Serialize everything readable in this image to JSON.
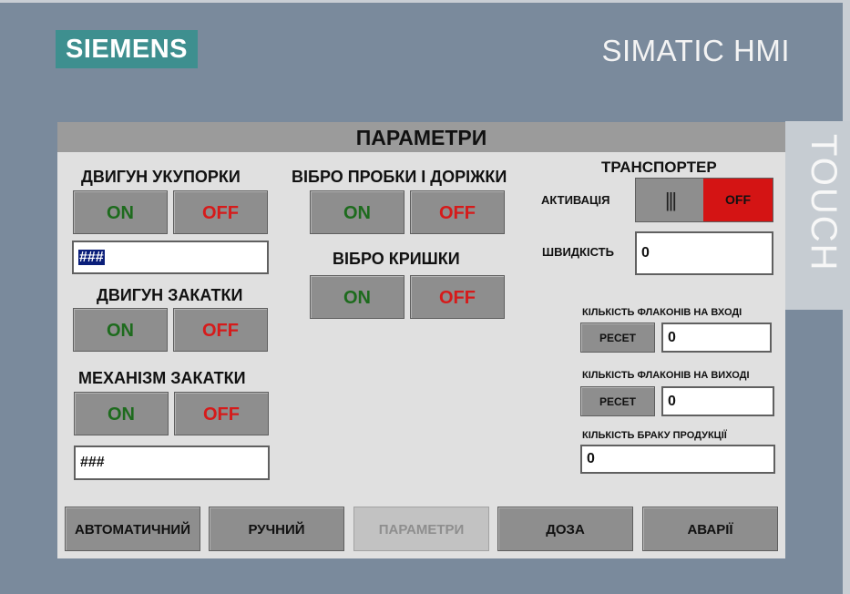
{
  "device": {
    "brand": "SIEMENS",
    "model": "SIMATIC HMI",
    "touch_label": "TOUCH"
  },
  "screen": {
    "title": "ПАРАМЕТРИ",
    "motor_capping": {
      "label": "ДВИГУН УКУПОРКИ",
      "on_label": "ON",
      "off_label": "OFF",
      "value": "###"
    },
    "motor_crimping": {
      "label": "ДВИГУН ЗАКАТКИ",
      "on_label": "ON",
      "off_label": "OFF"
    },
    "crimping_mechanism": {
      "label": "МЕХАНІЗМ ЗАКАТКИ",
      "on_label": "ON",
      "off_label": "OFF",
      "value": "###"
    },
    "vibro_cork_track": {
      "label": "ВІБРО ПРОБКИ І ДОРІЖКИ",
      "on_label": "ON",
      "off_label": "OFF"
    },
    "vibro_lids": {
      "label": "ВІБРО КРИШКИ",
      "on_label": "ON",
      "off_label": "OFF"
    },
    "conveyor": {
      "title": "ТРАНСПОРТЕР",
      "activation_label": "АКТИВАЦІЯ",
      "toggle_knob": "|||",
      "toggle_state": "OFF",
      "speed_label": "ШВИДКІСТЬ",
      "speed_value": "0"
    },
    "counters": {
      "input_label": "КІЛЬКІСТЬ ФЛАКОНІВ НА ВХОДІ",
      "input_reset": "РЕСЕТ",
      "input_value": "0",
      "output_label": "КІЛЬКІСТЬ ФЛАКОНІВ НА ВИХОДІ",
      "output_reset": "РЕСЕТ",
      "output_value": "0",
      "defects_label": "КІЛЬКІСТЬ БРАКУ ПРОДУКЦІЇ",
      "defects_value": "0"
    },
    "nav": [
      {
        "label": "АВТОМАТИЧНИЙ",
        "enabled": true
      },
      {
        "label": "РУЧНИЙ",
        "enabled": true
      },
      {
        "label": "ПАРАМЕТРИ",
        "enabled": false
      },
      {
        "label": "ДОЗА",
        "enabled": true
      },
      {
        "label": "АВАРІЇ",
        "enabled": true
      }
    ]
  },
  "colors": {
    "on_text": "#1d6b1d",
    "off_text": "#d61a1a",
    "toggle_off_bg": "#d41414",
    "brand_bg": "#3e8f8f"
  }
}
